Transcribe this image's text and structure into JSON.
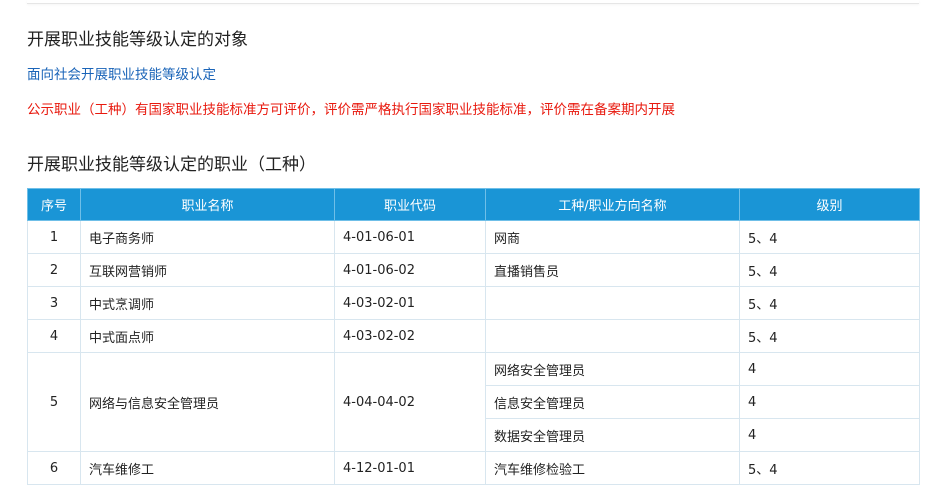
{
  "section1": {
    "title": "开展职业技能等级认定的对象",
    "link": "面向社会开展职业技能等级认定",
    "note": "公示职业（工种）有国家职业技能标准方可评价，评价需严格执行国家职业技能标准，评价需在备案期内开展"
  },
  "section2": {
    "title": "开展职业技能等级认定的职业（工种）"
  },
  "table": {
    "headers": [
      "序号",
      "职业名称",
      "职业代码",
      "工种/职业方向名称",
      "级别"
    ],
    "rows": [
      {
        "no": "1",
        "name": "电子商务师",
        "code": "4-01-06-01",
        "subs": [
          {
            "type": "网商",
            "level": "5、4"
          }
        ]
      },
      {
        "no": "2",
        "name": "互联网营销师",
        "code": "4-01-06-02",
        "subs": [
          {
            "type": "直播销售员",
            "level": "5、4"
          }
        ]
      },
      {
        "no": "3",
        "name": "中式烹调师",
        "code": "4-03-02-01",
        "subs": [
          {
            "type": "",
            "level": "5、4"
          }
        ]
      },
      {
        "no": "4",
        "name": "中式面点师",
        "code": "4-03-02-02",
        "subs": [
          {
            "type": "",
            "level": "5、4"
          }
        ]
      },
      {
        "no": "5",
        "name": "网络与信息安全管理员",
        "code": "4-04-04-02",
        "subs": [
          {
            "type": "网络安全管理员",
            "level": "4"
          },
          {
            "type": "信息安全管理员",
            "level": "4"
          },
          {
            "type": "数据安全管理员",
            "level": "4"
          }
        ]
      },
      {
        "no": "6",
        "name": "汽车维修工",
        "code": "4-12-01-01",
        "subs": [
          {
            "type": "汽车维修检验工",
            "level": "5、4"
          }
        ]
      }
    ]
  }
}
